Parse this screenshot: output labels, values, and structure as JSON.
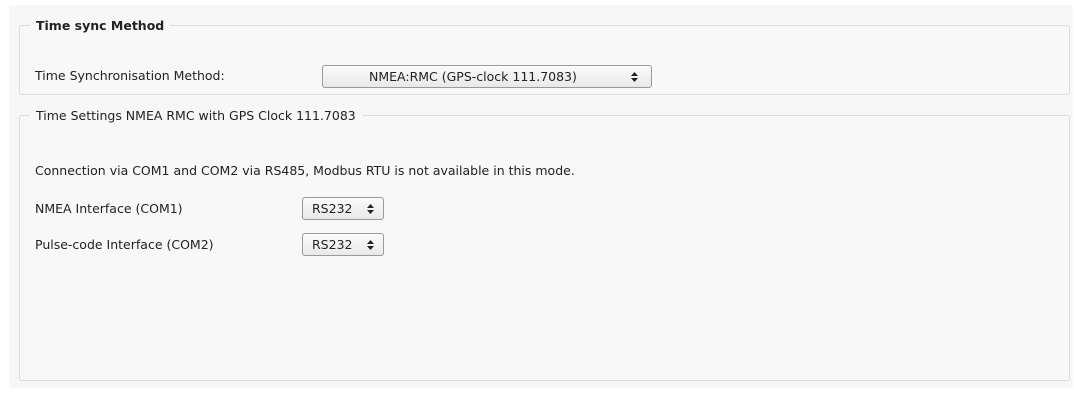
{
  "method_group": {
    "legend": "Time sync Method",
    "label": "Time Synchronisation Method:",
    "selected": "NMEA:RMC (GPS-clock 111.7083)"
  },
  "settings_group": {
    "legend": "Time Settings NMEA RMC with GPS Clock 111.7083",
    "info": "Connection via COM1 and COM2 via RS485, Modbus RTU is not available in this mode.",
    "nmea_interface": {
      "label": "NMEA Interface (COM1)",
      "selected": "RS232"
    },
    "pulse_interface": {
      "label": "Pulse-code Interface (COM2)",
      "selected": "RS232"
    }
  },
  "icons": {
    "select_arrow": "up-down-chevron-icon"
  }
}
